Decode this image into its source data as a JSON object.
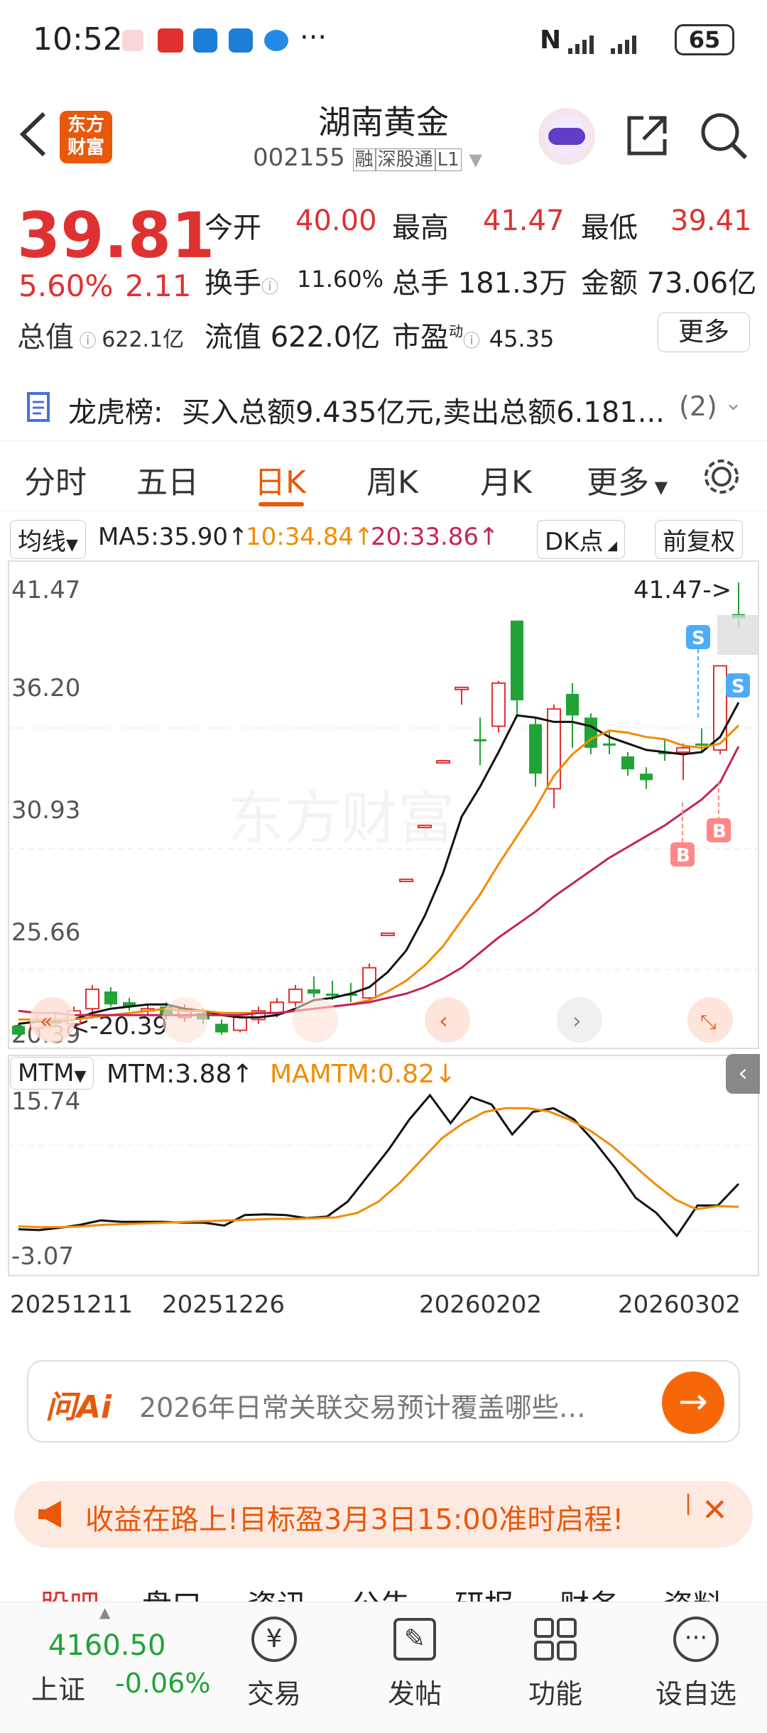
{
  "status": {
    "time": "10:52",
    "battery": "65",
    "dots": "···"
  },
  "header": {
    "logo": "东方\n财富",
    "name": "湖南黄金",
    "code": "002155",
    "badge1": "融",
    "badge2": "深股通",
    "badge3": "L1"
  },
  "quote": {
    "price": "39.81",
    "pct": "5.60%",
    "chg": "2.11",
    "rows": [
      [
        {
          "k": "今开",
          "v": "40.00"
        },
        {
          "k": "最高",
          "v": "41.47"
        },
        {
          "k": "最低",
          "v": "39.41"
        }
      ],
      [
        {
          "k": "换手",
          "v": "11.60%"
        },
        {
          "k": "总手",
          "v": "181.3万"
        },
        {
          "k": "金额",
          "v": "73.06亿"
        }
      ],
      [
        {
          "k": "总值",
          "v": "622.1亿"
        },
        {
          "k": "流值",
          "v": "622.0亿"
        },
        {
          "k": "市盈",
          "v": "45.35"
        }
      ]
    ],
    "more": "更多",
    "pe_sup": "动"
  },
  "lhb": {
    "label": "龙虎榜:",
    "text": "买入总额9.435亿元,卖出总额6.181...",
    "count": "(2)"
  },
  "tabs": [
    "分时",
    "五日",
    "日K",
    "周K",
    "月K",
    "更多"
  ],
  "chart": {
    "ma_label": "均线",
    "ma5": "MA5:35.90↑",
    "ma10": "10:34.84↑",
    "ma20": "20:33.86↑",
    "dk": "DK点",
    "fq": "前复权",
    "y_labels": [
      "41.47",
      "36.20",
      "30.93",
      "25.66",
      "20.39"
    ],
    "high_tag": "41.47->",
    "low_tag": "<-20.39",
    "watermark": "东方财富",
    "mtm_label": "MTM",
    "mtm_value": "MTM:3.88↑",
    "mamtm_value": "MAMTM:0.82↓",
    "mtm_y": [
      "15.74",
      "-3.07"
    ],
    "x_labels": [
      "20251211",
      "20251226",
      "20260202",
      "20260302"
    ]
  },
  "chart_data": {
    "type": "candlestick",
    "ylim": [
      20.39,
      41.47
    ],
    "candles": [
      {
        "o": 20.5,
        "c": 20.9,
        "h": 21.0,
        "l": 20.39,
        "up": false
      },
      {
        "o": 20.8,
        "c": 21.2,
        "h": 21.4,
        "l": 20.6,
        "up": true
      },
      {
        "o": 21.2,
        "c": 21.0,
        "h": 21.5,
        "l": 20.8,
        "up": false
      },
      {
        "o": 21.0,
        "c": 21.6,
        "h": 21.8,
        "l": 20.9,
        "up": true
      },
      {
        "o": 21.7,
        "c": 22.6,
        "h": 22.8,
        "l": 21.5,
        "up": true
      },
      {
        "o": 22.5,
        "c": 21.9,
        "h": 22.7,
        "l": 21.8,
        "up": false
      },
      {
        "o": 22.0,
        "c": 21.8,
        "h": 22.2,
        "l": 21.6,
        "up": false
      },
      {
        "o": 21.6,
        "c": 21.7,
        "h": 21.9,
        "l": 21.4,
        "up": true
      },
      {
        "o": 21.8,
        "c": 21.4,
        "h": 22.0,
        "l": 21.2,
        "up": false
      },
      {
        "o": 21.3,
        "c": 21.7,
        "h": 21.9,
        "l": 21.1,
        "up": true
      },
      {
        "o": 21.5,
        "c": 21.2,
        "h": 21.7,
        "l": 21.0,
        "up": false
      },
      {
        "o": 21.0,
        "c": 20.6,
        "h": 21.2,
        "l": 20.5,
        "up": false
      },
      {
        "o": 20.7,
        "c": 21.3,
        "h": 21.5,
        "l": 20.6,
        "up": true
      },
      {
        "o": 21.2,
        "c": 21.6,
        "h": 21.8,
        "l": 21.0,
        "up": true
      },
      {
        "o": 21.5,
        "c": 22.0,
        "h": 22.2,
        "l": 21.3,
        "up": true
      },
      {
        "o": 22.0,
        "c": 22.6,
        "h": 22.8,
        "l": 21.8,
        "up": true
      },
      {
        "o": 22.6,
        "c": 22.4,
        "h": 23.2,
        "l": 22.2,
        "up": false
      },
      {
        "o": 22.4,
        "c": 22.3,
        "h": 23.0,
        "l": 22.1,
        "up": false
      },
      {
        "o": 22.3,
        "c": 22.4,
        "h": 22.9,
        "l": 22.0,
        "up": false
      },
      {
        "o": 22.2,
        "c": 23.6,
        "h": 23.8,
        "l": 22.1,
        "up": true
      },
      {
        "o": 25.2,
        "c": 25.2,
        "h": 25.2,
        "l": 25.2,
        "up": true
      },
      {
        "o": 27.7,
        "c": 27.7,
        "h": 27.7,
        "l": 27.7,
        "up": true
      },
      {
        "o": 30.2,
        "c": 30.2,
        "h": 30.2,
        "l": 30.2,
        "up": true
      },
      {
        "o": 33.2,
        "c": 33.2,
        "h": 33.2,
        "l": 33.2,
        "up": true
      },
      {
        "o": 36.6,
        "c": 36.6,
        "h": 36.6,
        "l": 35.8,
        "up": true
      },
      {
        "o": 34.1,
        "c": 34.2,
        "h": 35.2,
        "l": 33.0,
        "up": false
      },
      {
        "o": 34.8,
        "c": 36.8,
        "h": 36.9,
        "l": 34.5,
        "up": true
      },
      {
        "o": 39.7,
        "c": 36.0,
        "h": 39.7,
        "l": 35.2,
        "up": false
      },
      {
        "o": 34.9,
        "c": 32.6,
        "h": 35.2,
        "l": 32.0,
        "up": false
      },
      {
        "o": 31.9,
        "c": 35.6,
        "h": 35.8,
        "l": 31.0,
        "up": true
      },
      {
        "o": 36.3,
        "c": 35.3,
        "h": 36.8,
        "l": 33.8,
        "up": false
      },
      {
        "o": 35.2,
        "c": 33.8,
        "h": 35.4,
        "l": 33.5,
        "up": false
      },
      {
        "o": 34.0,
        "c": 33.9,
        "h": 34.6,
        "l": 33.5,
        "up": false
      },
      {
        "o": 33.4,
        "c": 32.8,
        "h": 33.6,
        "l": 32.5,
        "up": false
      },
      {
        "o": 32.6,
        "c": 32.3,
        "h": 32.9,
        "l": 31.9,
        "up": false
      },
      {
        "o": 33.6,
        "c": 33.5,
        "h": 34.2,
        "l": 33.2,
        "up": false
      },
      {
        "o": 33.6,
        "c": 33.8,
        "h": 34.0,
        "l": 32.3,
        "up": true
      },
      {
        "o": 33.9,
        "c": 34.0,
        "h": 34.7,
        "l": 33.6,
        "up": false
      },
      {
        "o": 33.7,
        "c": 37.6,
        "h": 37.6,
        "l": 33.5,
        "up": true
      },
      {
        "o": 40.0,
        "c": 39.81,
        "h": 41.47,
        "l": 39.41,
        "up": false
      }
    ],
    "ma5": [
      21.0,
      21.1,
      21.1,
      21.2,
      21.5,
      21.7,
      21.8,
      21.9,
      21.9,
      21.7,
      21.6,
      21.4,
      21.3,
      21.3,
      21.4,
      21.7,
      22.1,
      22.2,
      22.4,
      22.7,
      23.4,
      24.4,
      26.0,
      28.0,
      30.6,
      32.0,
      33.6,
      35.3,
      35.2,
      35.0,
      35.0,
      34.8,
      34.3,
      34.0,
      33.7,
      33.6,
      33.5,
      33.6,
      34.3,
      35.9
    ],
    "ma10": [
      21.2,
      21.2,
      21.2,
      21.2,
      21.3,
      21.4,
      21.5,
      21.6,
      21.7,
      21.6,
      21.6,
      21.5,
      21.5,
      21.5,
      21.5,
      21.6,
      21.7,
      21.8,
      21.9,
      22.1,
      22.5,
      23.0,
      23.7,
      24.6,
      25.8,
      27.0,
      28.4,
      29.7,
      31.0,
      32.5,
      33.5,
      34.2,
      34.6,
      34.5,
      34.3,
      34.2,
      33.9,
      33.8,
      34.0,
      34.84
    ],
    "ma20": [
      21.6,
      21.5,
      21.5,
      21.4,
      21.4,
      21.4,
      21.4,
      21.4,
      21.4,
      21.4,
      21.4,
      21.4,
      21.4,
      21.5,
      21.5,
      21.6,
      21.7,
      21.8,
      21.9,
      22.0,
      22.2,
      22.4,
      22.7,
      23.1,
      23.6,
      24.3,
      25.0,
      25.6,
      26.2,
      26.9,
      27.5,
      28.1,
      28.7,
      29.2,
      29.7,
      30.2,
      30.8,
      31.4,
      32.2,
      33.86
    ],
    "mtm": [
      -2.2,
      -2.3,
      -2.0,
      -1.6,
      -1.0,
      -1.2,
      -1.2,
      -1.2,
      -1.3,
      -1.3,
      -1.7,
      -0.3,
      -0.2,
      -0.3,
      -0.7,
      -0.5,
      1.5,
      5.0,
      8.5,
      12.5,
      15.74,
      12.0,
      15.5,
      14.5,
      10.5,
      13.5,
      14.0,
      12.5,
      9.5,
      6.0,
      2.0,
      0.0,
      -3.07,
      1.0,
      1.0,
      3.88
    ],
    "mamtm": [
      -1.8,
      -1.9,
      -1.9,
      -1.8,
      -1.6,
      -1.5,
      -1.4,
      -1.3,
      -1.2,
      -1.1,
      -1.0,
      -0.9,
      -0.8,
      -0.8,
      -0.7,
      -0.6,
      0.0,
      1.5,
      4.0,
      7.0,
      10.0,
      12.0,
      13.5,
      14.0,
      14.0,
      13.6,
      12.5,
      11.0,
      9.0,
      6.5,
      4.0,
      1.8,
      0.5,
      0.9,
      0.82
    ]
  },
  "ask": {
    "brand": "问Ai",
    "text": "2026年日常关联交易预计覆盖哪些…"
  },
  "promo": {
    "text": "收益在路上!目标盈3月3日15:00准时启程!"
  },
  "subtabs": [
    "股吧",
    "盘口",
    "资讯",
    "公告",
    "研报",
    "财务",
    "资料"
  ],
  "bottom": {
    "index_value": "4160.50",
    "index_name": "上证",
    "index_pct": "-0.06%",
    "items": [
      "交易",
      "发帖",
      "功能",
      "设自选"
    ]
  }
}
